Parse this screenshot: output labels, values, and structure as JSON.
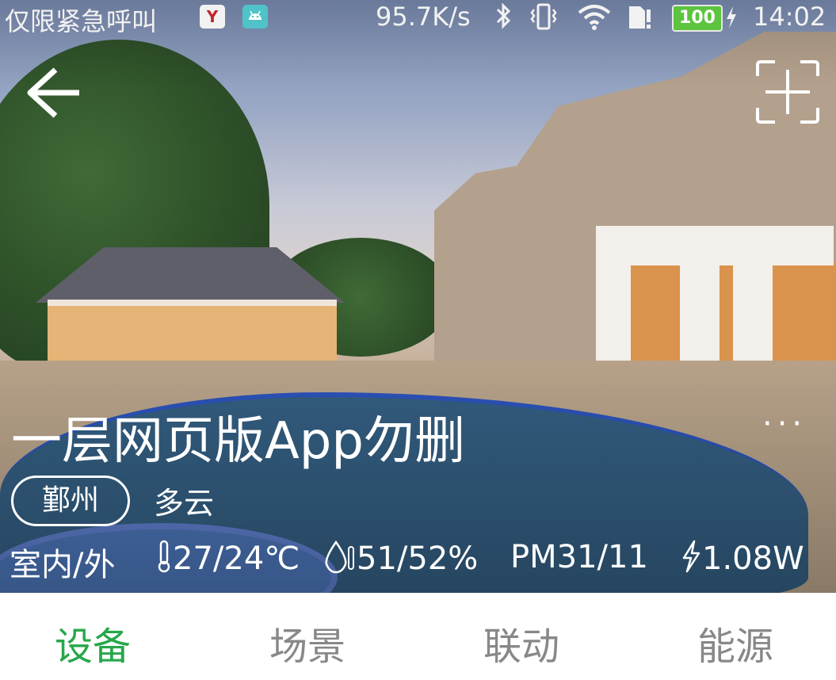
{
  "status_bar": {
    "carrier_text": "仅限紧急呼叫",
    "app_icons": [
      "yandex-icon",
      "android-icon"
    ],
    "net_speed": "95.7K/s",
    "battery_percent": "100",
    "time": "14:02"
  },
  "header": {
    "back_icon": "arrow-left-icon",
    "scan_icon": "scan-add-icon"
  },
  "home": {
    "title": "一层网页版App勿删",
    "more_label": "···",
    "city": "鄞州",
    "weather": "多云"
  },
  "metrics": {
    "indoor_outdoor_label": "室内/外",
    "temperature": "27/24℃",
    "humidity": "51/52%",
    "pm": "PM31/11",
    "power": "1.08W"
  },
  "tabs": [
    {
      "label": "设备",
      "active": true
    },
    {
      "label": "场景",
      "active": false
    },
    {
      "label": "联动",
      "active": false
    },
    {
      "label": "能源",
      "active": false
    }
  ],
  "colors": {
    "accent_green": "#27a74a",
    "tab_inactive": "#888888",
    "text_on_image": "#ffffff"
  }
}
